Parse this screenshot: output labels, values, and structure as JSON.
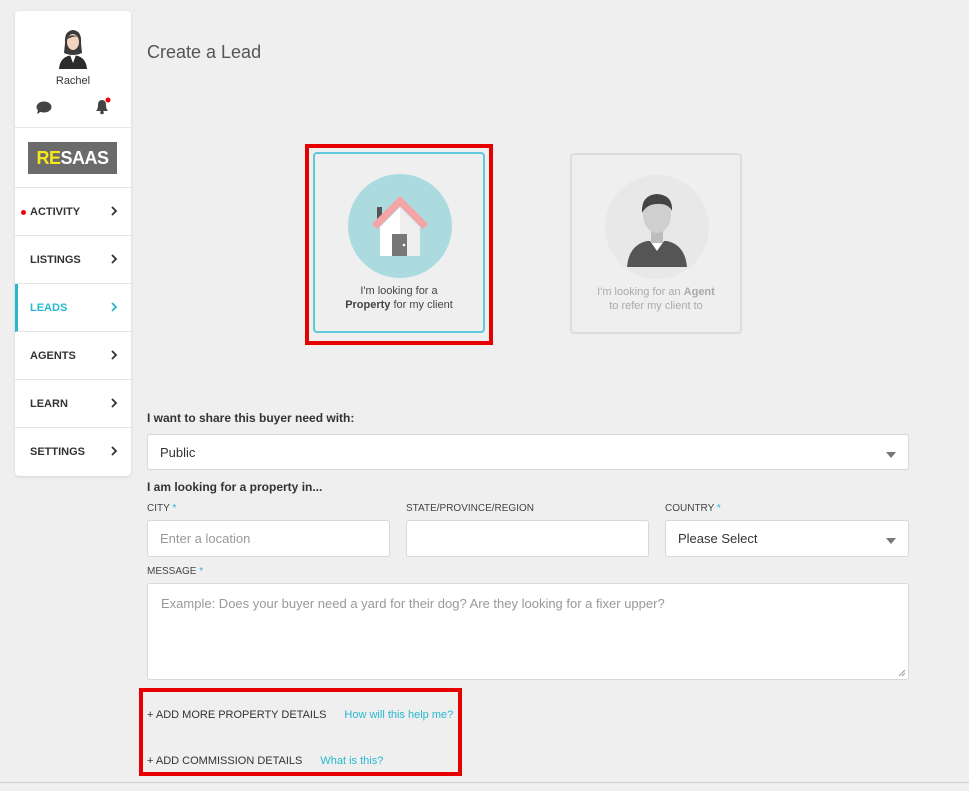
{
  "user": {
    "name": "Rachel"
  },
  "logo": {
    "prefix": "RE",
    "suffix": "SAAS"
  },
  "nav": [
    {
      "label": "ACTIVITY",
      "notify": true
    },
    {
      "label": "LISTINGS"
    },
    {
      "label": "LEADS",
      "active": true
    },
    {
      "label": "AGENTS"
    },
    {
      "label": "LEARN"
    },
    {
      "label": "SETTINGS"
    }
  ],
  "page_title": "Create a Lead",
  "cards": {
    "property": {
      "line1": "I'm looking for a",
      "bold": "Property",
      "line2_rest": " for my client",
      "icon": "house-icon"
    },
    "agent": {
      "line1_pre": "I'm looking for an ",
      "bold": "Agent",
      "line2": "to refer my client to",
      "icon": "agent-avatar-icon"
    }
  },
  "form": {
    "share_label": "I want to share this buyer need with:",
    "share_value": "Public",
    "location_label": "I am looking for a property in...",
    "city_label": "CITY",
    "city_placeholder": "Enter a location",
    "state_label": "STATE/PROVINCE/REGION",
    "country_label": "COUNTRY",
    "country_value": "Please Select",
    "message_label": "MESSAGE",
    "message_placeholder": "Example: Does your buyer need a yard for their dog? Are they looking for a fixer upper?",
    "required_mark": "*"
  },
  "links": {
    "property_details": "+ ADD MORE PROPERTY DETAILS",
    "property_help": "How will this help me?",
    "commission_details": "+ ADD COMMISSION DETAILS",
    "commission_help": "What is this?"
  },
  "colors": {
    "accent": "#27b8d0",
    "highlight": "#e60000",
    "notify": "#ee0011"
  }
}
